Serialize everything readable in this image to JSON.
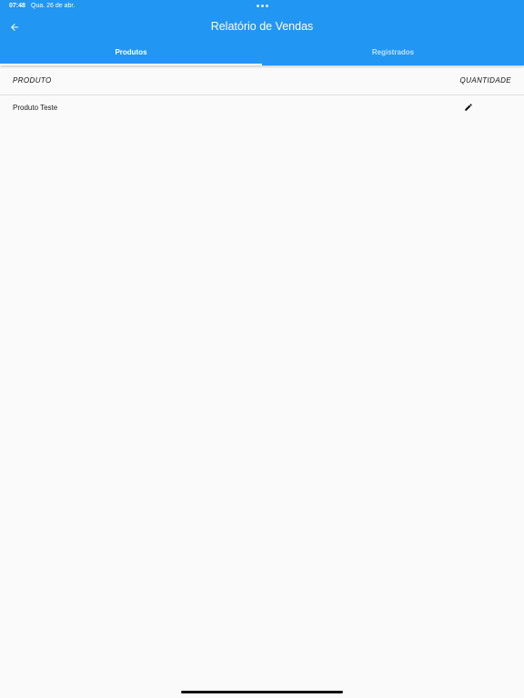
{
  "status_bar": {
    "time": "07:48",
    "date": "Qua. 26 de abr."
  },
  "header": {
    "title": "Relatório de Vendas",
    "back_icon": "arrow-back-icon",
    "background_color": "#2196f3"
  },
  "tabs": [
    {
      "label": "Produtos",
      "active": true
    },
    {
      "label": "Registrados",
      "active": false
    }
  ],
  "table": {
    "columns": [
      "PRODUTO",
      "QUANTIDADE"
    ],
    "rows": [
      {
        "name": "Produto Teste",
        "action_icon": "edit-pencil-icon"
      }
    ]
  }
}
